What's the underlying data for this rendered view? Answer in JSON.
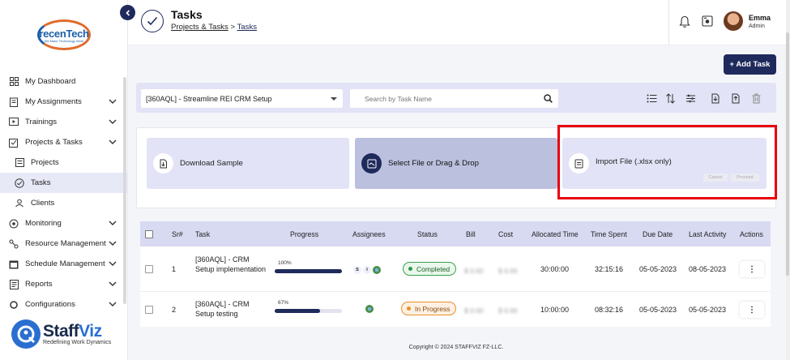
{
  "logo": {
    "brand_a": "recen",
    "brand_b": "Tech",
    "tagline": "We Make Technology Work"
  },
  "sidebar": {
    "items": [
      {
        "label": "My Dashboard",
        "icon": "dashboard-icon",
        "chevron": false
      },
      {
        "label": "My Assignments",
        "icon": "assignments-icon",
        "chevron": true
      },
      {
        "label": "Trainings",
        "icon": "training-icon",
        "chevron": true
      },
      {
        "label": "Projects & Tasks",
        "icon": "projects-tasks-icon",
        "chevron": true
      },
      {
        "label": "Projects",
        "icon": "projects-icon",
        "chevron": false,
        "sub": true
      },
      {
        "label": "Tasks",
        "icon": "tasks-icon",
        "chevron": false,
        "sub": true,
        "active": true
      },
      {
        "label": "Clients",
        "icon": "clients-icon",
        "chevron": false,
        "sub": true
      },
      {
        "label": "Monitoring",
        "icon": "monitoring-icon",
        "chevron": true
      },
      {
        "label": "Resource Management",
        "icon": "resource-icon",
        "chevron": true
      },
      {
        "label": "Schedule Management",
        "icon": "schedule-icon",
        "chevron": true
      },
      {
        "label": "Reports",
        "icon": "reports-icon",
        "chevron": true
      },
      {
        "label": "Configurations",
        "icon": "config-icon",
        "chevron": true
      }
    ]
  },
  "brand": {
    "name_a": "Staff",
    "name_b": "Viz",
    "tagline": "Redefining Work Dynamics"
  },
  "header": {
    "title": "Tasks",
    "breadcrumb_1": "Projects & Tasks",
    "breadcrumb_sep": ">",
    "breadcrumb_2": "Tasks",
    "user_name": "Emma",
    "user_role": "Admin"
  },
  "add_task_label": "+ Add Task",
  "toolbar": {
    "project_value": "[360AQL] - Streamline REI CRM Setup",
    "search_placeholder": "Search by Task Name"
  },
  "import": {
    "download_label": "Download Sample",
    "select_label": "Select File or Drag & Drop",
    "import_label": "Import File (.xlsx only)",
    "cancel_label": "Cancel",
    "proceed_label": "Proceed"
  },
  "table": {
    "headers": [
      "Sr#",
      "Task",
      "Progress",
      "Assignees",
      "Status",
      "Bill",
      "Cost",
      "Allocated Time",
      "Time Spent",
      "Due Date",
      "Last Activity",
      "Actions"
    ],
    "rows": [
      {
        "sr": "1",
        "task": "[360AQL] - CRM Setup implementation",
        "progress_label": "100%",
        "progress": 100,
        "assignees": [
          "S",
          "I"
        ],
        "status": "Completed",
        "bill": "$ 0.00",
        "cost": "$ 0.00",
        "allocated": "30:00:00",
        "spent": "32:15:16",
        "due": "05-05-2023",
        "last": "08-05-2023",
        "action": "⋮"
      },
      {
        "sr": "2",
        "task": "[360AQL] - CRM Setup testing",
        "progress_label": "67%",
        "progress": 67,
        "assignees": [],
        "status": "In Progress",
        "bill": "$ 0.00",
        "cost": "$ 0.00",
        "allocated": "10:00:00",
        "spent": "08:32:16",
        "due": "05-05-2023",
        "last": "05-05-2023",
        "action": "⋮"
      }
    ]
  },
  "footer": "Copyright © 2024 STAFFVIZ FZ-LLC.",
  "colors": {
    "primary": "#1f2a5c",
    "panel": "#e2e3f6",
    "highlight": "#e8000b",
    "completed": "#2f9a40",
    "in_progress": "#e8902c"
  }
}
